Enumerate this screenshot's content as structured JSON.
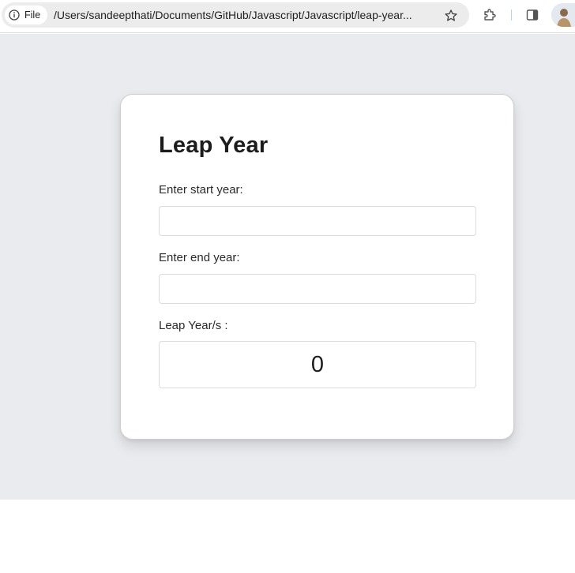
{
  "browser": {
    "site_chip_label": "File",
    "url": "/Users/sandeepthati/Documents/GitHub/Javascript/Javascript/leap-year...",
    "icons": {
      "site_info": "info-circle-icon",
      "bookmark": "star-icon",
      "extensions": "puzzle-icon",
      "side_panel": "side-panel-icon",
      "profile": "avatar"
    }
  },
  "page": {
    "title": "Leap Year",
    "start_label": "Enter start year:",
    "start_value": "",
    "end_label": "Enter end year:",
    "end_value": "",
    "result_label": "Leap Year/s :",
    "result_value": "0"
  },
  "colors": {
    "page_background": "#eaebef",
    "card_background": "#ffffff",
    "toolbar_omnibox": "#ececec"
  }
}
